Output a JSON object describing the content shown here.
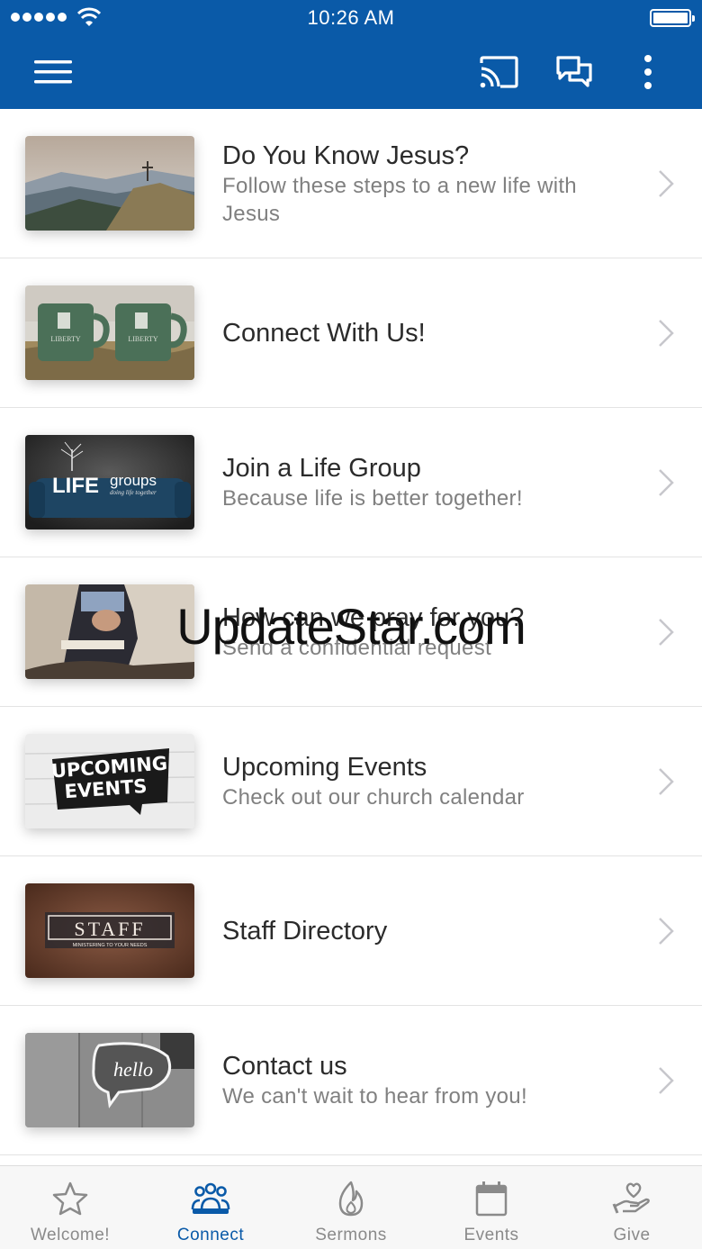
{
  "status_bar": {
    "time": "10:26 AM"
  },
  "app_bar": {
    "menu_icon": "hamburger-menu-icon",
    "cast_icon": "cast-icon",
    "chat_icon": "chat-bubbles-icon",
    "more_icon": "more-vertical-icon",
    "background_color": "#0a5aa8"
  },
  "list": {
    "items": [
      {
        "title": "Do You Know Jesus?",
        "subtitle": "Follow these steps to a new life with Jesus"
      },
      {
        "title": "Connect With Us!",
        "subtitle": ""
      },
      {
        "title": "Join a Life Group",
        "subtitle": "Because life is better together!"
      },
      {
        "title": "How can we pray for you?",
        "subtitle": "Send a confidential request"
      },
      {
        "title": "Upcoming Events",
        "subtitle": "Check out our church calendar"
      },
      {
        "title": "Staff Directory",
        "subtitle": ""
      },
      {
        "title": "Contact us",
        "subtitle": "We can't wait to hear from you!"
      }
    ]
  },
  "thumbnails": {
    "mug_text": "LIBERTY",
    "life_word": "LIFE",
    "groups_word": "groups",
    "groups_tagline": "doing life together",
    "events_line1": "UPCOMING",
    "events_line2": "EVENTS",
    "staff_word": "STAFF",
    "staff_tagline": "MINISTERING TO YOUR NEEDS",
    "hello_word": "hello"
  },
  "watermark": "UpdateStar.com",
  "tabs": [
    {
      "label": "Welcome!",
      "icon": "star-icon",
      "active": false
    },
    {
      "label": "Connect",
      "icon": "people-icon",
      "active": true
    },
    {
      "label": "Sermons",
      "icon": "flame-icon",
      "active": false
    },
    {
      "label": "Events",
      "icon": "calendar-icon",
      "active": false
    },
    {
      "label": "Give",
      "icon": "heart-hand-icon",
      "active": false
    }
  ],
  "colors": {
    "accent": "#0a5aa8",
    "inactive_tab": "#8a8a8a"
  }
}
